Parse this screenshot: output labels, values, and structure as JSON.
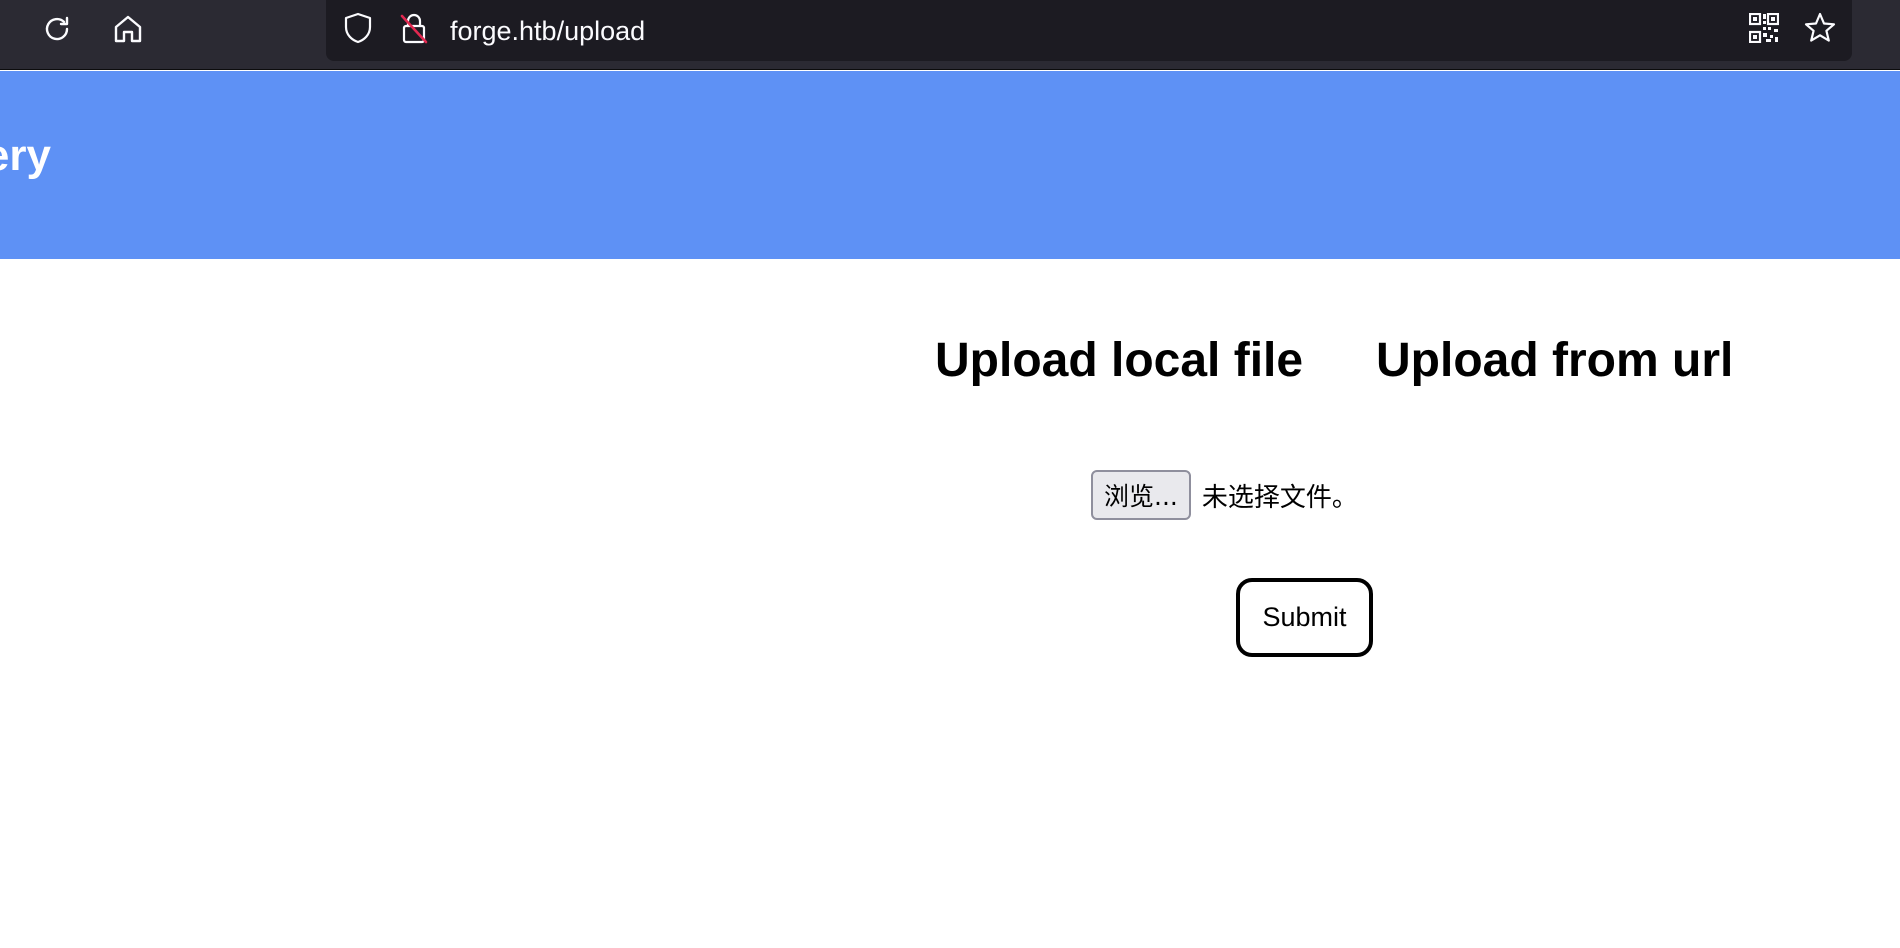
{
  "browser": {
    "url": "forge.htb/upload",
    "icons": {
      "reload": "reload-icon",
      "home": "home-icon",
      "shield": "shield-icon",
      "insecure_lock": "insecure-lock-icon",
      "qr_code": "qr-code-icon",
      "bookmark": "star-icon"
    }
  },
  "header": {
    "title": "ery",
    "background_color": "#5e91f5"
  },
  "tabs": [
    {
      "label": "Upload local file"
    },
    {
      "label": "Upload from url"
    }
  ],
  "file_input": {
    "button_label": "浏览...",
    "status": "未选择文件。"
  },
  "submit": {
    "label": "Submit"
  }
}
